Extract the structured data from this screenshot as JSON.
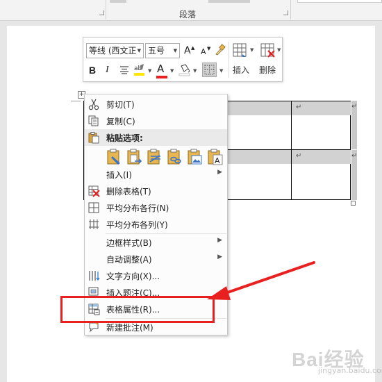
{
  "ribbon": {
    "paragraph_group_label": "段落"
  },
  "mini_toolbar": {
    "font_name": "等线 (西文正",
    "font_size": "五号",
    "grow_font": "A",
    "shrink_font": "A",
    "bold": "B",
    "italic": "I",
    "font_color_letter": "A",
    "insert_label": "插入",
    "delete_label": "删除",
    "highlight_color": "#ffe600",
    "font_color": "#e8201f"
  },
  "table": {
    "cell_mark": "↵"
  },
  "context_menu": {
    "items": [
      {
        "label": "剪切(T)",
        "icon": "scissors-icon"
      },
      {
        "label": "复制(C)",
        "icon": "copy-icon"
      },
      {
        "label": "粘贴选项:",
        "icon": "paste-icon"
      },
      {
        "label": "插入(I)",
        "icon": "",
        "submenu": true
      },
      {
        "label": "删除表格(T)",
        "icon": "delete-table-icon"
      },
      {
        "label": "平均分布各行(N)",
        "icon": "distribute-rows-icon"
      },
      {
        "label": "平均分布各列(Y)",
        "icon": "distribute-columns-icon"
      },
      {
        "label": "边框样式(B)",
        "icon": "",
        "submenu": true
      },
      {
        "label": "自动调整(A)",
        "icon": "",
        "submenu": true
      },
      {
        "label": "文字方向(X)...",
        "icon": "text-direction-icon"
      },
      {
        "label": "插入题注(C)...",
        "icon": "insert-caption-icon"
      },
      {
        "label": "表格属性(R)...",
        "icon": "table-properties-icon"
      },
      {
        "label": "新建批注(M)",
        "icon": "new-comment-icon"
      }
    ],
    "submenu_arrow": "▶"
  },
  "annotation": {
    "color": "#e8201f"
  },
  "watermark": {
    "logo_text": "Bai经验",
    "sub_text": "jingyan.baidu.com"
  }
}
